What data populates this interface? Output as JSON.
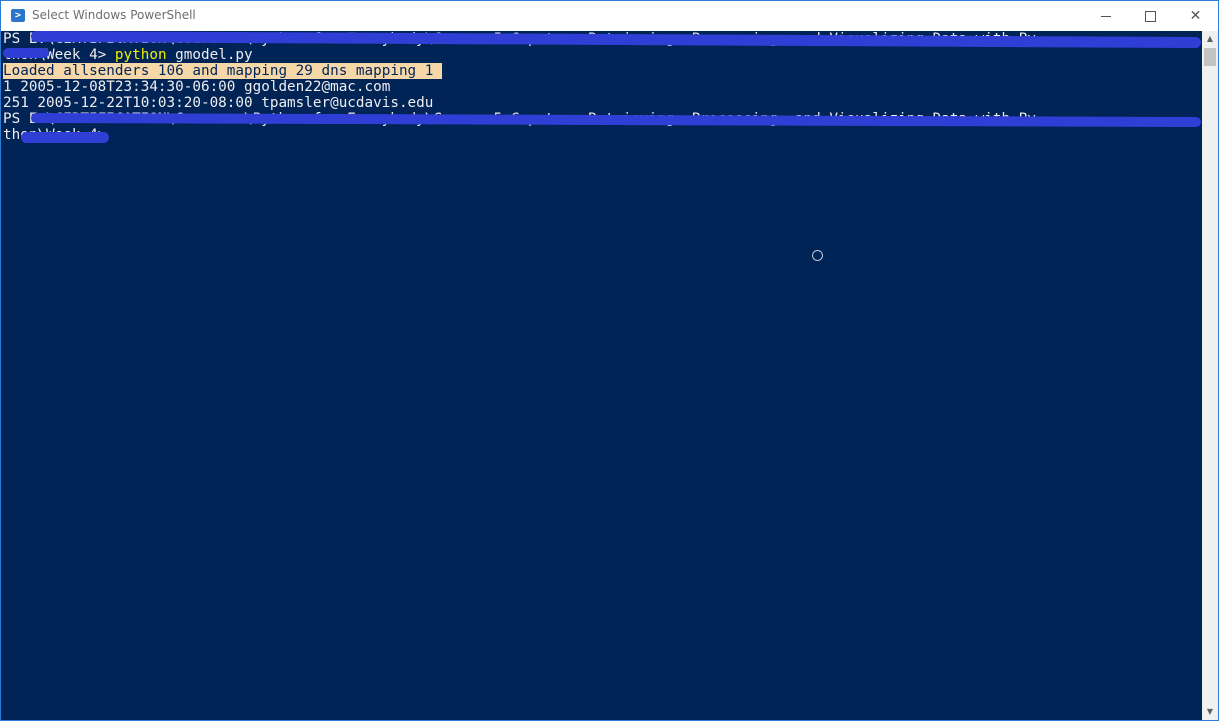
{
  "window": {
    "title": "Select Windows PowerShell",
    "icon": "powershell-icon",
    "controls": {
      "minimize_icon": "minimize-icon",
      "maximize_icon": "maximize-icon",
      "close_glyph": "✕"
    }
  },
  "console": {
    "lines": [
      {
        "text": "PS E:\\CERTIFICATION\\Coursera\\Python for Everybody\\Course-5 Capstone Retrieving, Processing, and Visualizing Data with Py"
      },
      {
        "text_prefix": "thon\\Week 4> ",
        "command_word": "python",
        "command_rest": " gmodel.py"
      },
      {
        "text": "Loaded allsenders 106 and mapping 29 dns mapping 1 "
      },
      {
        "text": "1 2005-12-08T23:34:30-06:00 ggolden22@mac.com"
      },
      {
        "text": "251 2005-12-22T10:03:20-08:00 tpamsler@ucdavis.edu"
      },
      {
        "text": "PS E:\\CERTIFICATION\\Coursera\\Python for Everybody\\Course-5 Capstone Retrieving, Processing, and Visualizing Data with Py"
      },
      {
        "text": "thon\\Week 4>"
      }
    ],
    "colors": {
      "background": "#012456",
      "foreground": "#eeedf0",
      "command_highlight": "#f0f000",
      "selection_background": "#f6d7a8",
      "redaction_ink": "#2f3fd6"
    }
  },
  "scrollbar": {
    "up_glyph": "▲",
    "down_glyph": "▼"
  }
}
